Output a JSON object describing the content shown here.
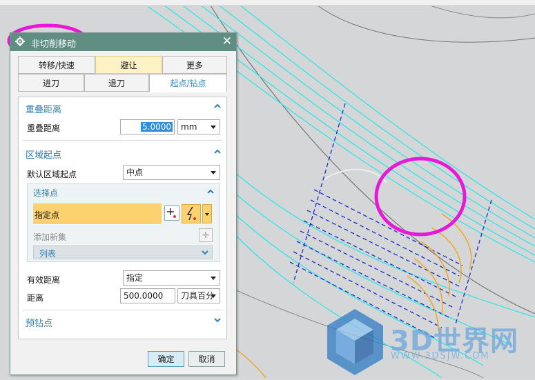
{
  "dialog": {
    "title": "非切削移动",
    "tabs_row1": [
      "转移/快速",
      "避让",
      "更多"
    ],
    "tabs_row2": [
      "进刀",
      "退刀",
      "起点/钻点"
    ]
  },
  "overlap": {
    "header": "重叠距离",
    "label": "重叠距离",
    "value": "5.0000",
    "unit": "mm"
  },
  "region_start": {
    "header": "区域起点",
    "default_label": "默认区域起点",
    "default_value": "中点",
    "select_points": {
      "header": "选择点",
      "specify_label": "指定点",
      "add_new_set": "添加新集",
      "list_label": "列表"
    },
    "valid_distance_label": "有效距离",
    "valid_distance_value": "指定",
    "distance_label": "距离",
    "distance_value": "500.0000",
    "distance_unit": "刀具百分"
  },
  "predrill": {
    "header": "预钻点"
  },
  "buttons": {
    "ok": "确定",
    "cancel": "取消"
  },
  "watermark": {
    "brand": "3D世界网",
    "url": "WWW.3DSJW.COM"
  },
  "colors": {
    "titlebar": "#5e8f82",
    "highlight_ring": "#e619d8",
    "toolpath_cyan": "#2ee6e6",
    "toolpath_blue": "#1a2cc8",
    "toolpath_orange": "#f2a51c"
  },
  "icons": [
    "gear-icon",
    "close-icon",
    "point-constructor-icon",
    "inferred-point-icon",
    "add-set-icon"
  ]
}
